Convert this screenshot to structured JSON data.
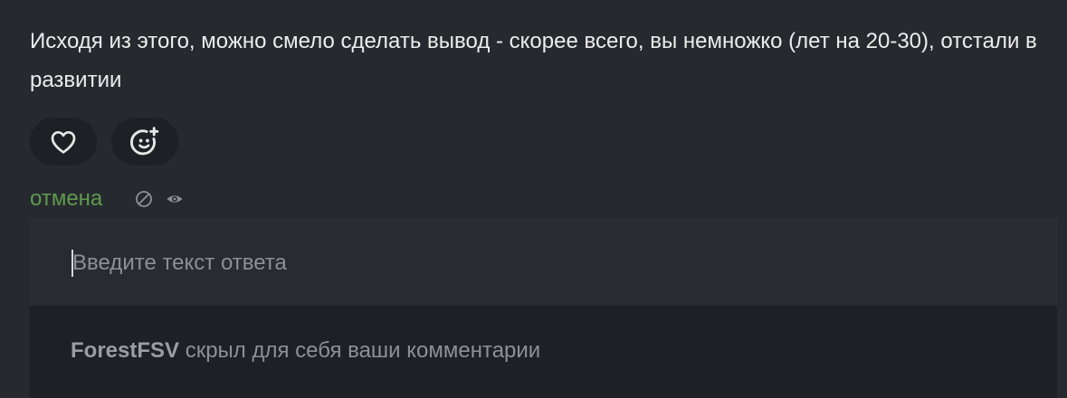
{
  "comment": {
    "text": "Исходя из этого, можно смело сделать вывод - скорее всего, вы немножко (лет на 20-30), отстали в развитии"
  },
  "actions": {
    "like_icon": "heart-icon",
    "react_icon": "emoji-add-icon"
  },
  "meta": {
    "cancel_label": "отмена",
    "block_icon": "block-icon",
    "preview_icon": "eye-icon"
  },
  "reply": {
    "placeholder": "Введите текст ответа",
    "value": ""
  },
  "notice": {
    "username": "ForestFSV",
    "message": " скрыл для себя ваши комментарии"
  },
  "colors": {
    "background": "#262a2f",
    "accent_green": "#5f9a4f",
    "pill_bg": "#1d2024"
  }
}
